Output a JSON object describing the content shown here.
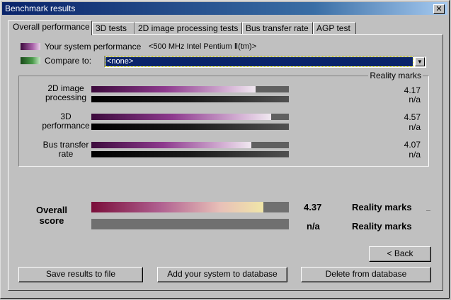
{
  "window": {
    "title": "Benchmark results",
    "close_glyph": "✕"
  },
  "tabs": [
    {
      "label": "Overall performance",
      "active": true
    },
    {
      "label": "3D tests"
    },
    {
      "label": "2D image processing tests"
    },
    {
      "label": "Bus transfer rate"
    },
    {
      "label": "AGP test"
    }
  ],
  "legend": {
    "system_label": "Your system performance",
    "system_value": "<500 MHz Intel Pentium Ⅱ(tm)>",
    "compare_label": "Compare to:",
    "compare_value": "<none>"
  },
  "group": {
    "title": "Reality marks",
    "rows": [
      {
        "label_line1": "2D image",
        "label_line2": "processing",
        "system_value": "4.17",
        "system_fraction": 0.83,
        "compare_value": "n/a"
      },
      {
        "label_line1": "3D",
        "label_line2": "performance",
        "system_value": "4.57",
        "system_fraction": 0.91,
        "compare_value": "n/a"
      },
      {
        "label_line1": "Bus transfer",
        "label_line2": "rate",
        "system_value": "4.07",
        "system_fraction": 0.81,
        "compare_value": "n/a"
      }
    ]
  },
  "overall": {
    "label_line1": "Overall",
    "label_line2": "score",
    "system_value": "4.37",
    "system_fraction": 0.87,
    "system_unit": "Reality marks",
    "compare_value": "n/a",
    "compare_unit": "Reality marks"
  },
  "buttons": {
    "back": "< Back",
    "save": "Save results to file",
    "add": "Add your system to database",
    "delete": "Delete from database"
  },
  "colors": {
    "title_bar": "#0a246a",
    "selection": "#0a246a",
    "system_swatch": "#8e3a8e",
    "compare_swatch": "#2e6a2e"
  }
}
